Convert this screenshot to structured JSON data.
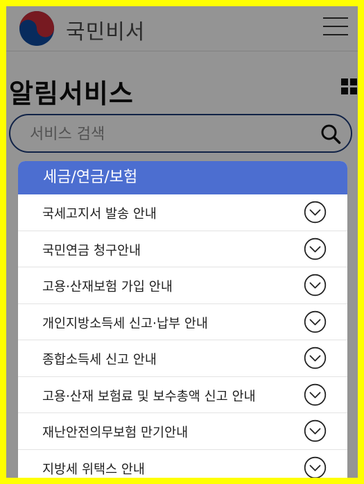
{
  "header": {
    "brand": "국민비서",
    "logo_icon": "taegeuk-logo-icon",
    "menu_icon": "hamburger-menu-icon"
  },
  "page": {
    "title": "알림서비스",
    "view_icon": "grid-view-icon"
  },
  "search": {
    "placeholder": "서비스 검색",
    "icon": "search-icon"
  },
  "dropdown": {
    "category": "세금/연금/보험",
    "items": [
      {
        "label": "국세고지서 발송 안내"
      },
      {
        "label": "국민연금 청구안내"
      },
      {
        "label": "고용·산재보험 가입 안내"
      },
      {
        "label": "개인지방소득세 신고·납부 안내"
      },
      {
        "label": "종합소득세 신고 안내"
      },
      {
        "label": "고용·산재 보험료 및 보수총액 신고 안내"
      },
      {
        "label": "재난안전의무보험 만기안내"
      },
      {
        "label": "지방세 위택스 안내"
      }
    ],
    "item_icon": "chevron-down-circle-icon"
  },
  "colors": {
    "border": "#ffff00",
    "header_accent": "#4c6ed0",
    "search_border": "#1e3d7b"
  }
}
